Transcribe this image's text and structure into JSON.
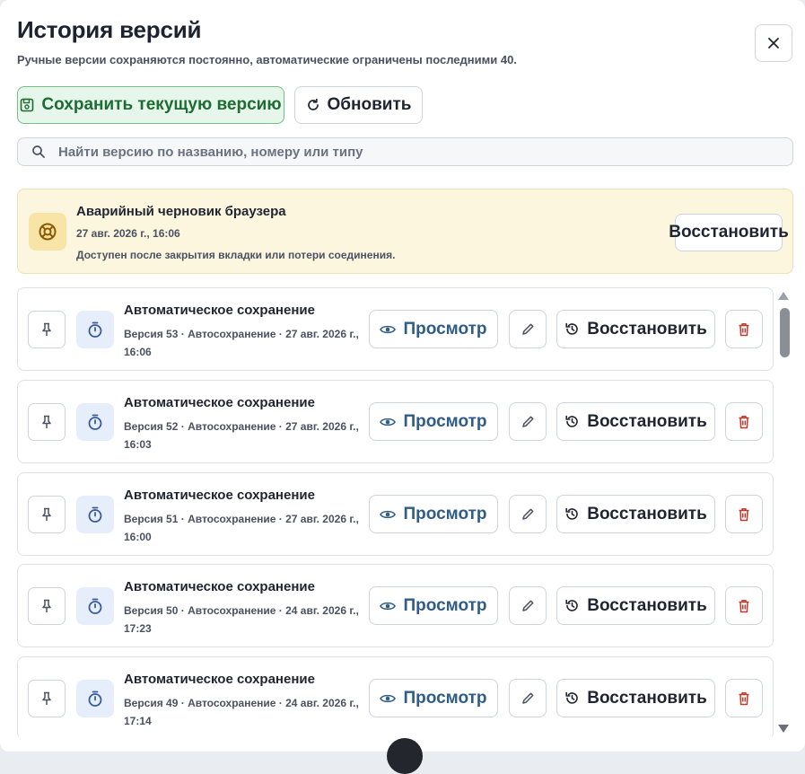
{
  "header": {
    "title": "История версий",
    "subtitle": "Ручные версии сохраняются постоянно, автоматические ограничены последними 40."
  },
  "toolbar": {
    "save_label": "Сохранить текущую версию",
    "refresh_label": "Обновить"
  },
  "search": {
    "placeholder": "Найти версию по названию, номеру или типу",
    "value": ""
  },
  "crash_draft": {
    "title": "Аварийный черновик браузера",
    "date": "27 авг. 2026 г., 16:06",
    "description": "Доступен после закрытия вкладки или потери соединения.",
    "restore_label": "Восстановить",
    "icon": "lifebuoy-icon"
  },
  "row_actions": {
    "view_label": "Просмотр",
    "restore_label": "Восстановить"
  },
  "versions": [
    {
      "title": "Автоматическое сохранение",
      "meta": "Версия 53 · Автосохранение · 27 авг. 2026 г., 16:06"
    },
    {
      "title": "Автоматическое сохранение",
      "meta": "Версия 52 · Автосохранение · 27 авг. 2026 г., 16:03"
    },
    {
      "title": "Автоматическое сохранение",
      "meta": "Версия 51 · Автосохранение · 27 авг. 2026 г., 16:00"
    },
    {
      "title": "Автоматическое сохранение",
      "meta": "Версия 50 · Автосохранение · 24 авг. 2026 г., 17:23"
    },
    {
      "title": "Автоматическое сохранение",
      "meta": "Версия 49 · Автосохранение · 24 авг. 2026 г., 17:14"
    }
  ],
  "colors": {
    "save_green": "#1e6b33",
    "view_blue": "#2f5c88",
    "delete_red": "#c0392b",
    "crash_bg": "#fdf6df"
  }
}
